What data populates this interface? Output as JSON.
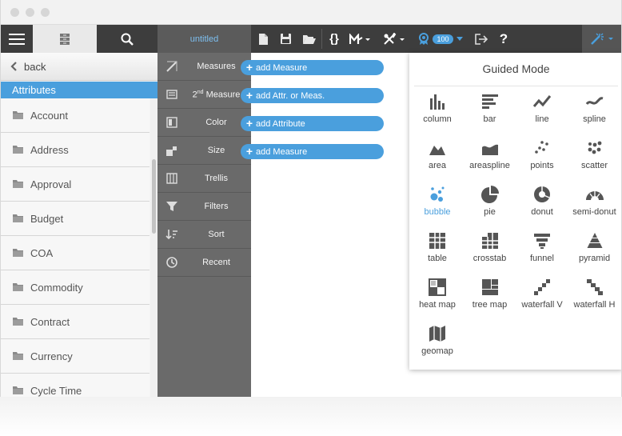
{
  "toolbar": {
    "title": "untitled",
    "badge_count": "100"
  },
  "left_panel": {
    "back_label": "back",
    "section_title": "Attributes",
    "items": [
      "Account",
      "Address",
      "Approval",
      "Budget",
      "COA",
      "Commodity",
      "Contract",
      "Currency",
      "Cycle Time"
    ]
  },
  "middle_panel": {
    "items": [
      {
        "label": "Measures",
        "icon": "measure-ruler-icon"
      },
      {
        "label_sup": "nd",
        "label_pre": "2",
        "label_post": " Measure",
        "icon": "second-measure-icon"
      },
      {
        "label": "Color",
        "icon": "color-swatch-icon"
      },
      {
        "label": "Size",
        "icon": "size-icon"
      },
      {
        "label": "Trellis",
        "icon": "trellis-icon"
      },
      {
        "label": "Filters",
        "icon": "filter-funnel-icon"
      },
      {
        "label": "Sort",
        "icon": "sort-icon"
      },
      {
        "label": "Recent",
        "icon": "clock-icon"
      }
    ]
  },
  "drop_targets": [
    "add Measure",
    "add Attr. or Meas.",
    "add Attribute",
    "add Measure"
  ],
  "guided_mode": {
    "title": "Guided Mode",
    "charts": [
      "column",
      "bar",
      "line",
      "spline",
      "area",
      "areaspline",
      "points",
      "scatter",
      "bubble",
      "pie",
      "donut",
      "semi-donut",
      "table",
      "crosstab",
      "funnel",
      "pyramid",
      "heat map",
      "tree map",
      "waterfall V",
      "waterfall H",
      "geomap"
    ],
    "selected": "bubble"
  },
  "colors": {
    "accent": "#4a9fdd",
    "toolbar": "#3d3d3d",
    "middle_panel": "#6a6a6a",
    "icon_gray": "#555555"
  }
}
